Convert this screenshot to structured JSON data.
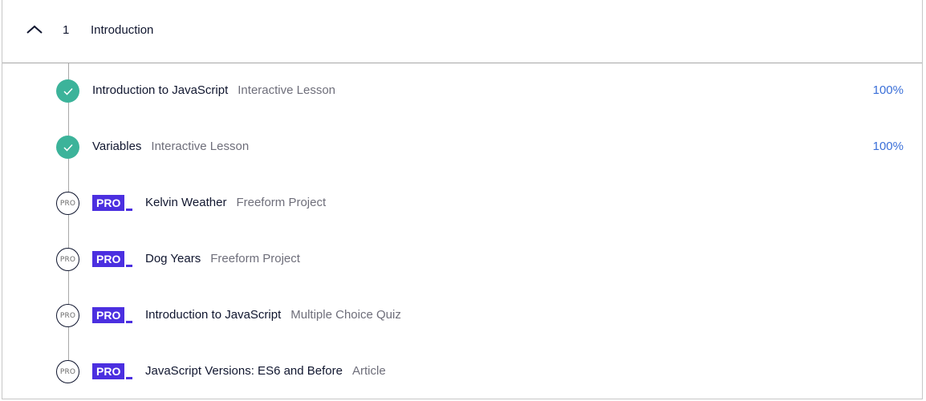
{
  "section": {
    "number": "1",
    "title": "Introduction",
    "icon": "chevron-up-icon"
  },
  "colors": {
    "complete": "#3cb39a",
    "pro": "#4b2fe0",
    "percent": "#3a6fd8"
  },
  "items": [
    {
      "name": "Introduction to JavaScript",
      "kind": "Interactive Lesson",
      "status": "complete",
      "percent": "100%"
    },
    {
      "name": "Variables",
      "kind": "Interactive Lesson",
      "status": "complete",
      "percent": "100%"
    },
    {
      "name": "Kelvin Weather",
      "kind": "Freeform Project",
      "status": "pro",
      "badge": "PRO",
      "status_label": "PRO"
    },
    {
      "name": "Dog Years",
      "kind": "Freeform Project",
      "status": "pro",
      "badge": "PRO",
      "status_label": "PRO"
    },
    {
      "name": "Introduction to JavaScript",
      "kind": "Multiple Choice Quiz",
      "status": "pro",
      "badge": "PRO",
      "status_label": "PRO"
    },
    {
      "name": "JavaScript Versions: ES6 and Before",
      "kind": "Article",
      "status": "pro",
      "badge": "PRO",
      "status_label": "PRO"
    }
  ]
}
